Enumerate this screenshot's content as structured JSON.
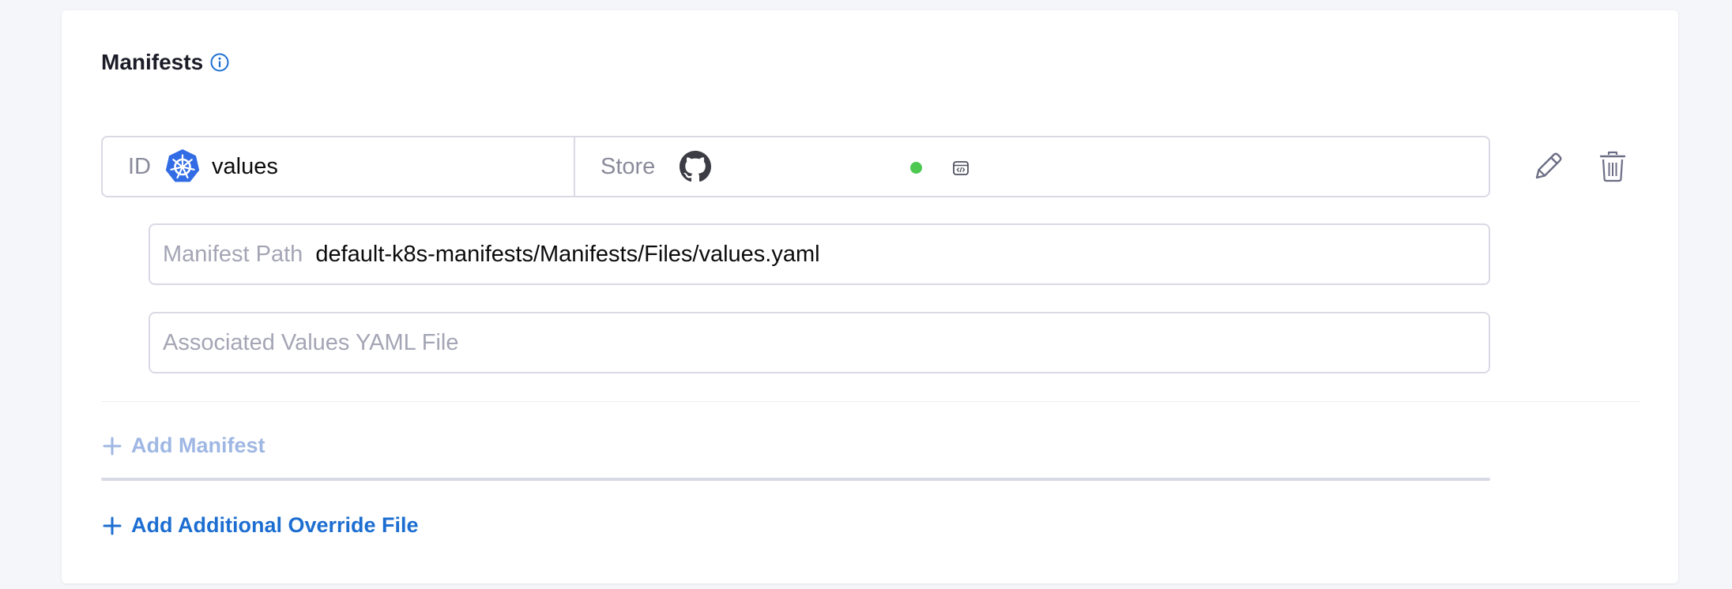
{
  "section": {
    "title": "Manifests"
  },
  "manifest": {
    "id_label": "ID",
    "id_value": "values",
    "store_label": "Store",
    "store_icon": "github-icon",
    "status_color": "#4dc952"
  },
  "fields": {
    "manifest_path_label": "Manifest Path",
    "manifest_path_value": "default-k8s-manifests/Manifests/Files/values.yaml",
    "values_placeholder": "Associated Values YAML File"
  },
  "actions": {
    "add_manifest": "Add Manifest",
    "add_override": "Add Additional Override File"
  },
  "colors": {
    "accent": "#1d6ed1",
    "disabled_accent": "#9fb7e3",
    "k8s_blue": "#326ce5"
  }
}
